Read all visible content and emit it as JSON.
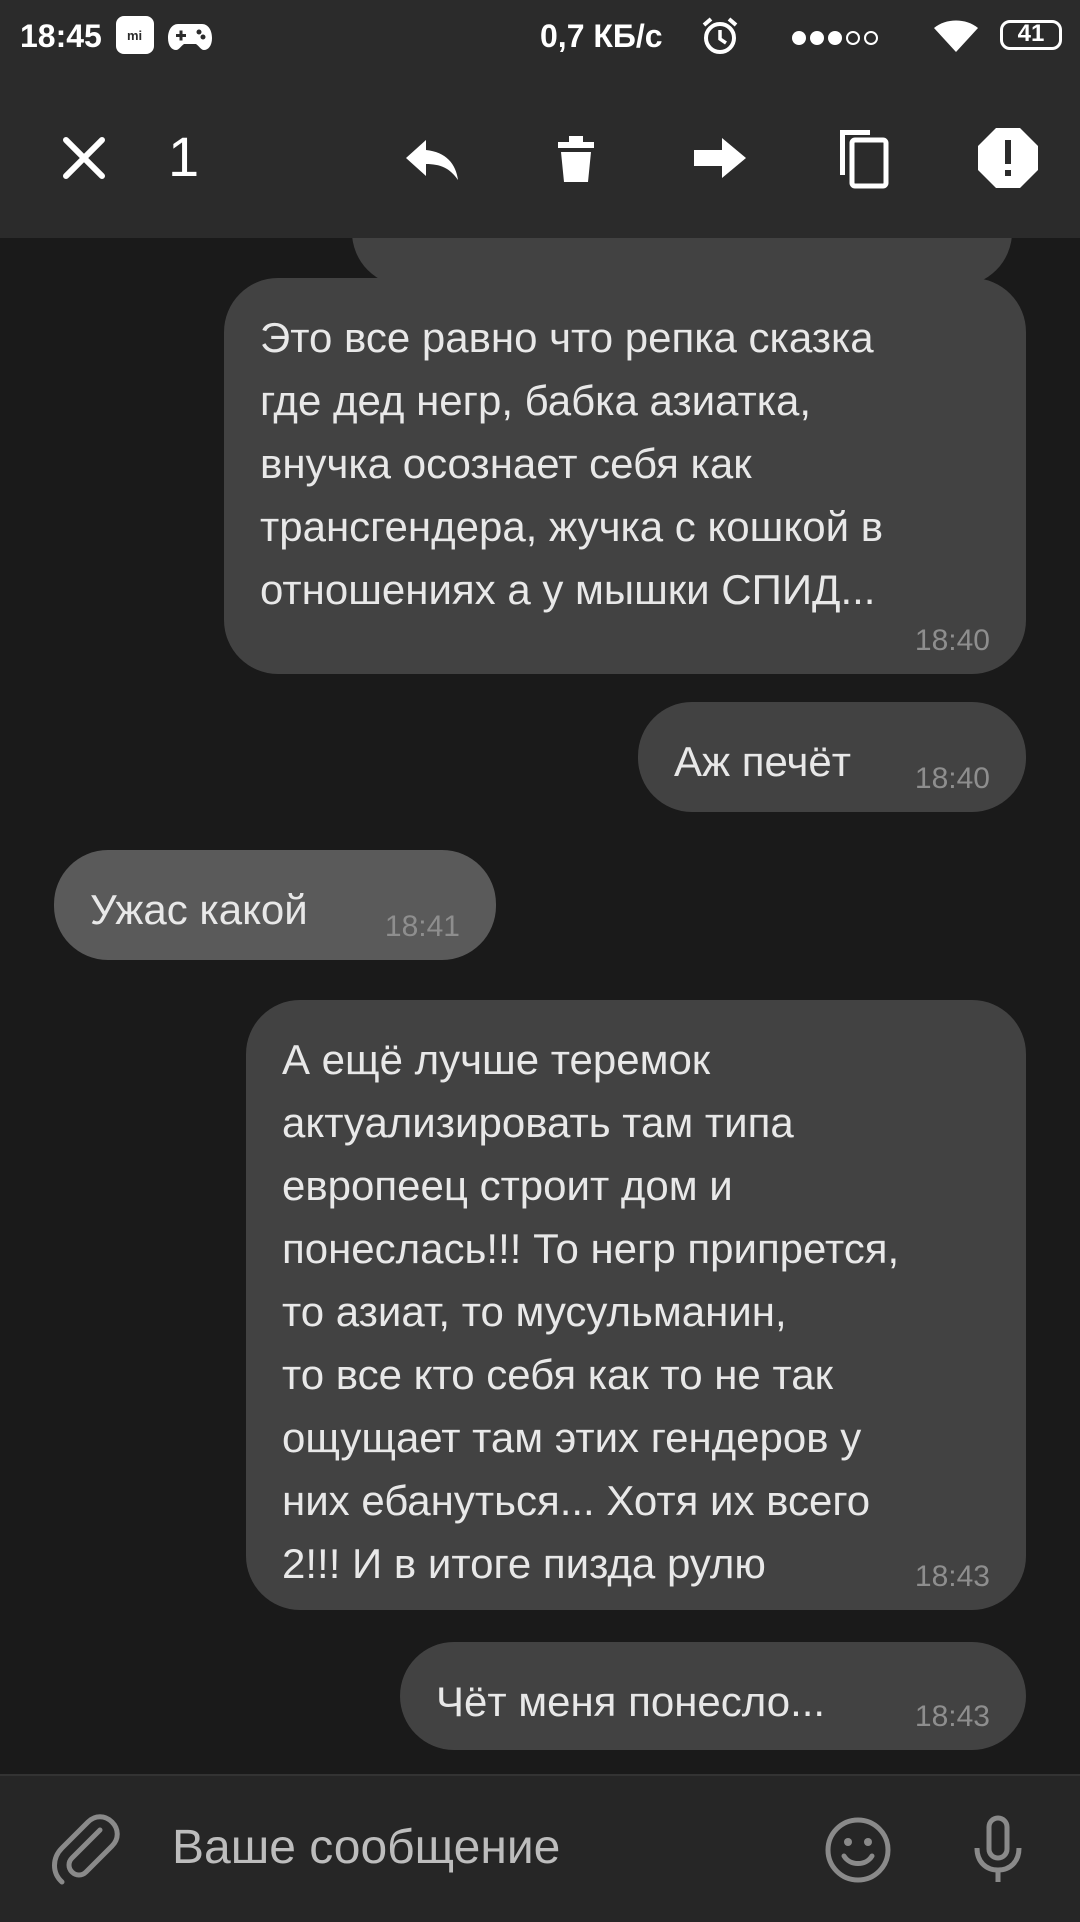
{
  "status_bar": {
    "time": "18:45",
    "mi_badge": "mi",
    "network_speed": "0,7 КБ/с",
    "battery": "41",
    "icons": [
      "mi-app-icon",
      "gamepad-icon",
      "alarm-icon",
      "signal-dots-icon",
      "wifi-icon",
      "battery-icon"
    ]
  },
  "action_bar": {
    "selected_count": "1",
    "icons": [
      "close-icon",
      "reply-icon",
      "delete-icon",
      "forward-icon",
      "copy-icon",
      "report-icon"
    ]
  },
  "messages": [
    {
      "direction": "out",
      "text": "Это все равно что репка сказка\nгде дед негр, бабка азиатка,\nвнучка осознает себя как\nтрансгендера, жучка с кошкой в\nотношениях а у мышки СПИД...",
      "time": "18:40"
    },
    {
      "direction": "out",
      "text": "Аж печёт",
      "time": "18:40"
    },
    {
      "direction": "in",
      "text": "Ужас какой",
      "time": "18:41"
    },
    {
      "direction": "out",
      "text": "А ещё лучше теремок\nактуализировать там типа\nевропеец строит дом и\nпонеслась!!! То негр припрется,\nто азиат, то мусульманин,\nто все кто себя как то не так\nощущает там этих гендеров у\nних ебануться... Хотя их всего\n2!!! И в итоге пизда рулю",
      "time": "18:43"
    },
    {
      "direction": "out",
      "text": "Чёт меня понесло...",
      "time": "18:43"
    }
  ],
  "input": {
    "placeholder": "Ваше сообщение",
    "icons": [
      "attach-icon",
      "emoji-icon",
      "microphone-icon"
    ]
  },
  "colors": {
    "background": "#1a1a1a",
    "bar": "#2b2b2b",
    "bubble_out": "#424242",
    "bubble_in": "#5a5a5a",
    "text": "#e8e8e8",
    "timestamp": "#8e8e8e"
  }
}
